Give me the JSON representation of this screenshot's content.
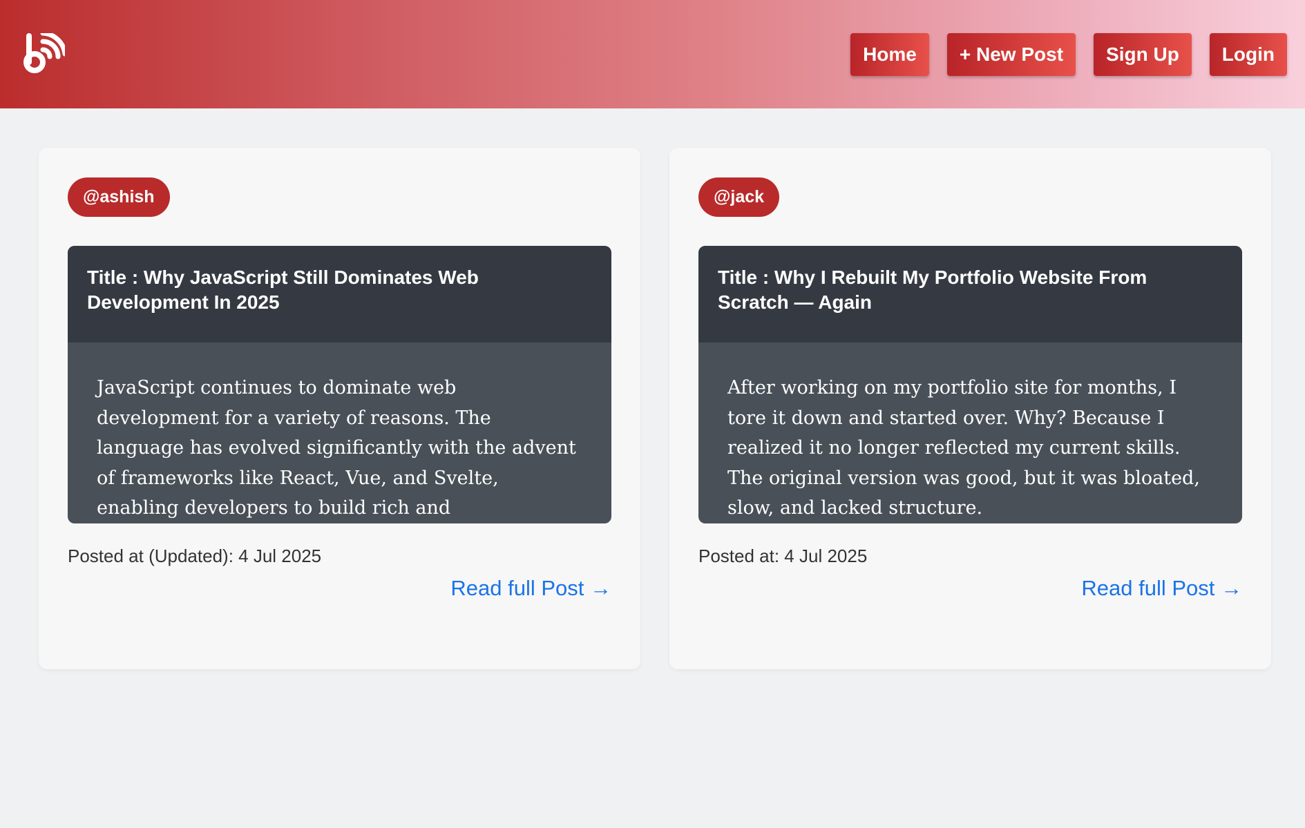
{
  "header": {
    "logo_icon": "blog-rss-logo-icon",
    "nav": [
      {
        "label": "Home"
      },
      {
        "label": "+ New Post"
      },
      {
        "label": "Sign Up"
      },
      {
        "label": "Login"
      }
    ]
  },
  "posts": [
    {
      "author": "@ashish",
      "title": "Title : Why JavaScript Still Dominates Web Development In 2025",
      "excerpt": "JavaScript continues to dominate web development for a variety of reasons. The language has evolved significantly with the advent of frameworks like React, Vue, and Svelte, enabling developers to build rich and",
      "posted": "Posted at (Updated): 4 Jul 2025",
      "link": "Read full Post →"
    },
    {
      "author": "@jack",
      "title": "Title : Why I Rebuilt My Portfolio Website From Scratch — Again",
      "excerpt": "After working on my portfolio site for months, I tore it down and started over. Why? Because I realized it no longer reflected my current skills. The original version was good, but it was bloated, slow, and lacked structure.",
      "posted": "Posted at: 4 Jul 2025",
      "link": "Read full Post →"
    }
  ],
  "colors": {
    "accent": "#b92a2a",
    "link": "#1a73e8",
    "card_title_bg": "#353a42",
    "card_body_bg": "#495058"
  }
}
